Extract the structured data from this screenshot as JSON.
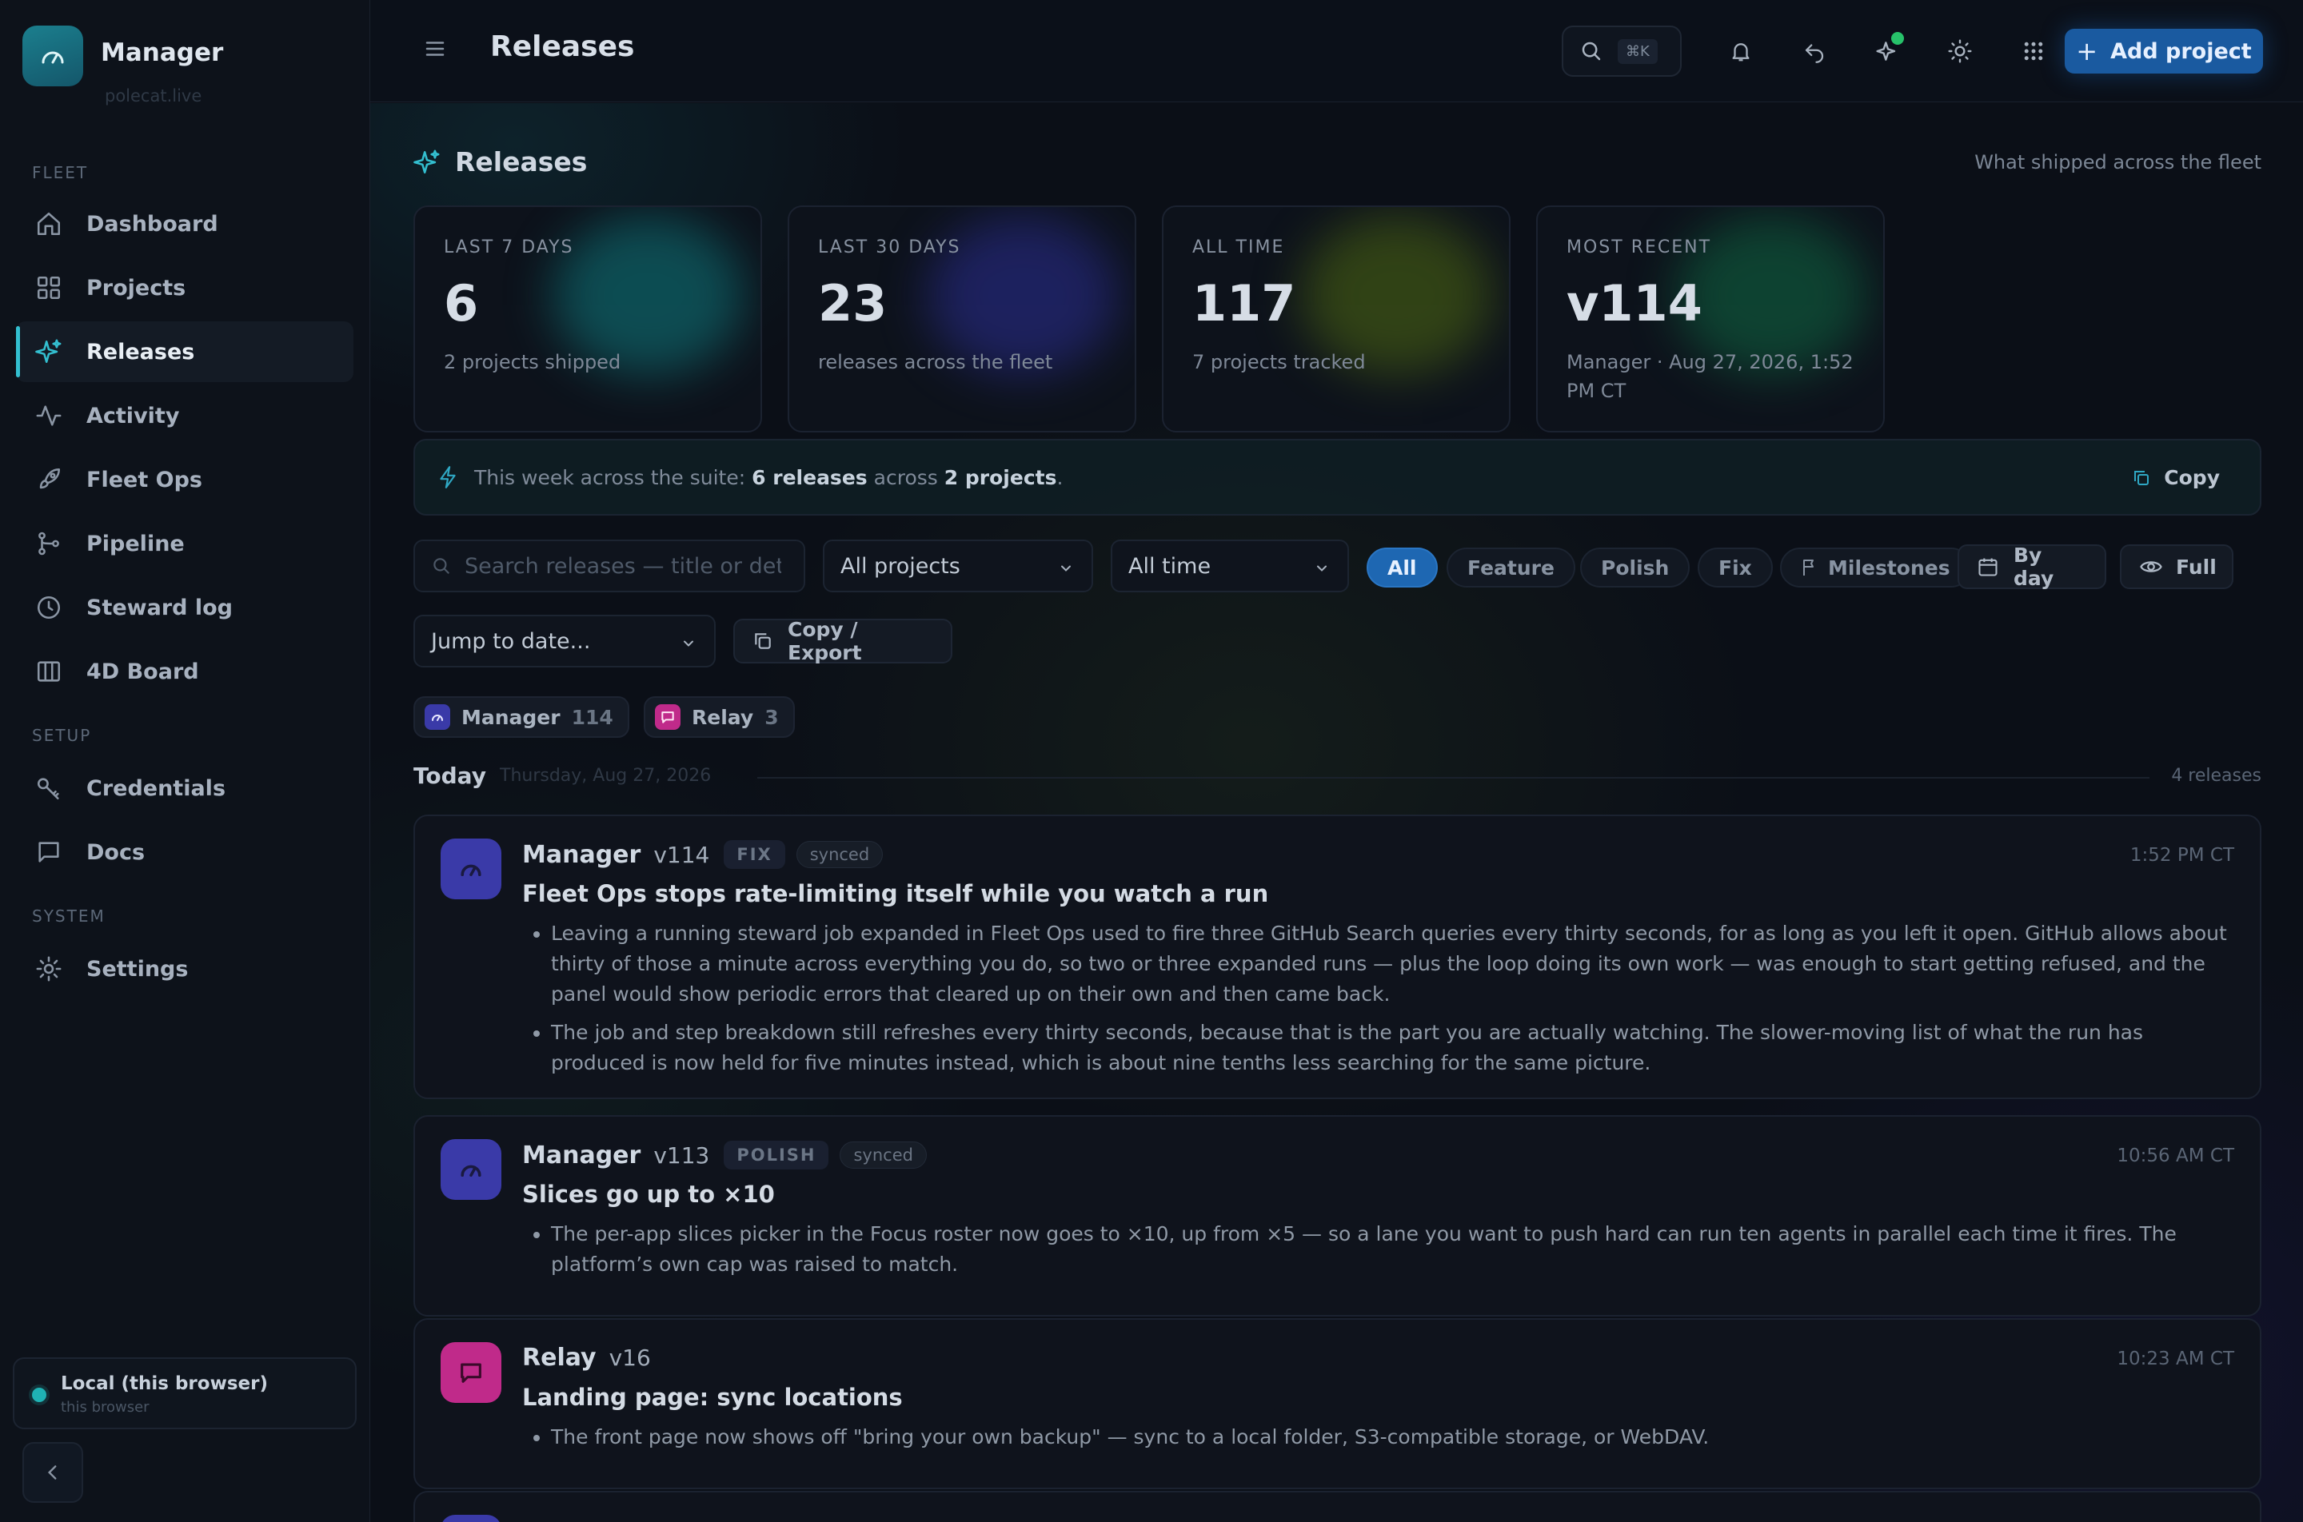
{
  "sidebar": {
    "brand_name": "Manager",
    "brand_sub": "polecat.live",
    "sections": {
      "fleet": "FLEET",
      "setup": "SETUP",
      "system": "SYSTEM"
    },
    "items": [
      {
        "label": "Dashboard",
        "icon": "home-icon"
      },
      {
        "label": "Projects",
        "icon": "grid-icon"
      },
      {
        "label": "Releases",
        "icon": "sparkle-icon"
      },
      {
        "label": "Activity",
        "icon": "activity-icon"
      },
      {
        "label": "Fleet Ops",
        "icon": "rocket-icon"
      },
      {
        "label": "Pipeline",
        "icon": "branch-icon"
      },
      {
        "label": "Steward log",
        "icon": "clock-icon"
      },
      {
        "label": "4D Board",
        "icon": "columns-icon"
      },
      {
        "label": "Credentials",
        "icon": "key-icon"
      },
      {
        "label": "Docs",
        "icon": "chat-icon"
      },
      {
        "label": "Settings",
        "icon": "gear-icon"
      }
    ],
    "local": {
      "title": "Local (this browser)",
      "sub": "this browser"
    }
  },
  "topbar": {
    "title": "Releases",
    "search_kbd": "⌘K",
    "add_project": "Add project"
  },
  "main": {
    "section_title": "Releases",
    "section_sub": "What shipped across the fleet",
    "stats": [
      {
        "label": "LAST 7 DAYS",
        "value": "6",
        "desc": "2 projects shipped"
      },
      {
        "label": "LAST 30 DAYS",
        "value": "23",
        "desc": "releases across the fleet"
      },
      {
        "label": "ALL TIME",
        "value": "117",
        "desc": "7 projects tracked"
      },
      {
        "label": "MOST RECENT",
        "value": "v114",
        "desc": "Manager · Aug 27, 2026, 1:52 PM CT"
      }
    ],
    "week": {
      "prefix": "This week across the suite:",
      "releases": "6 releases",
      "mid": "across",
      "projects": "2 projects",
      "end": ".",
      "copy": "Copy"
    },
    "filters": {
      "search_placeholder": "Search releases — title or details",
      "projects": "All projects",
      "time": "All time",
      "chips": [
        "All",
        "Feature",
        "Polish",
        "Fix",
        "Milestones"
      ],
      "by_day": "By day",
      "full": "Full",
      "jump": "Jump to date...",
      "export": "Copy / Export"
    },
    "project_chips": [
      {
        "name": "Manager",
        "count": "114"
      },
      {
        "name": "Relay",
        "count": "3"
      }
    ],
    "day": {
      "label": "Today",
      "date": "Thursday, Aug 27, 2026",
      "count": "4 releases"
    },
    "releases": [
      {
        "project": "Manager",
        "version": "v114",
        "tag": "FIX",
        "sync": "synced",
        "time": "1:52 PM CT",
        "title": "Fleet Ops stops rate-limiting itself while you watch a run",
        "bullets": [
          "Leaving a running steward job expanded in Fleet Ops used to fire three GitHub Search queries every thirty seconds, for as long as you left it open. GitHub allows about thirty of those a minute across everything you do, so two or three expanded runs — plus the loop doing its own work — was enough to start getting refused, and the panel would show periodic errors that cleared up on their own and then came back.",
          "The job and step breakdown still refreshes every thirty seconds, because that is the part you are actually watching. The slower-moving list of what the run has produced is now held for five minutes instead, which is about nine tenths less searching for the same picture."
        ]
      },
      {
        "project": "Manager",
        "version": "v113",
        "tag": "POLISH",
        "sync": "synced",
        "time": "10:56 AM CT",
        "title": "Slices go up to ×10",
        "bullets": [
          "The per-app slices picker in the Focus roster now goes to ×10, up from ×5 — so a lane you want to push hard can run ten agents in parallel each time it fires. The platform’s own cap was raised to match."
        ]
      },
      {
        "project": "Relay",
        "version": "v16",
        "time": "10:23 AM CT",
        "title": "Landing page: sync locations",
        "bullets": [
          "The front page now shows off \"bring your own backup\" — sync to a local folder, S3-compatible storage, or WebDAV."
        ]
      }
    ]
  },
  "colors": {
    "accent": "#33bfd0",
    "primary_button": "#1a5aa0",
    "manager_avatar": "#3a3aa8",
    "relay_avatar": "#c02a8a"
  }
}
